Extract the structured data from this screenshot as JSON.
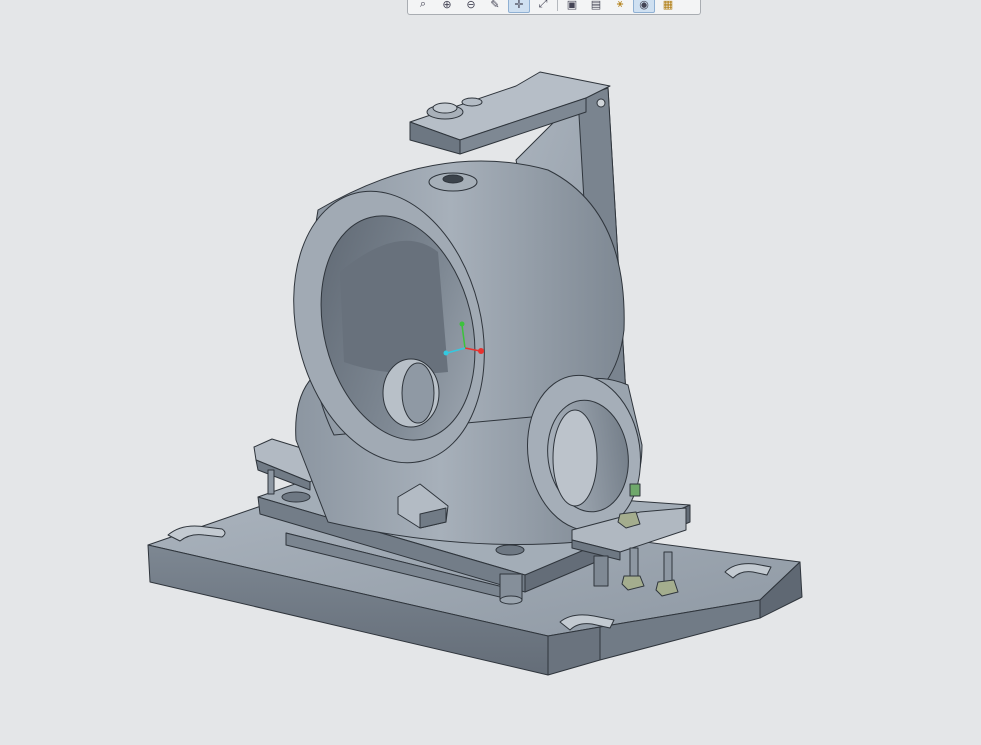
{
  "toolbar": {
    "buttons": [
      {
        "name": "zoom-fit-icon",
        "glyph": "⌕",
        "active": false
      },
      {
        "name": "zoom-in-icon",
        "glyph": "⊕",
        "active": false
      },
      {
        "name": "zoom-out-icon",
        "glyph": "⊖",
        "active": false
      },
      {
        "name": "repaint-icon",
        "glyph": "✎",
        "active": false
      },
      {
        "name": "spin-center-icon",
        "glyph": "✛",
        "active": true
      },
      {
        "name": "orient-icon",
        "glyph": "⤢",
        "active": false
      },
      {
        "name": "saved-views-icon",
        "glyph": "▣",
        "active": false
      },
      {
        "name": "layers-icon",
        "glyph": "▤",
        "active": false
      },
      {
        "name": "datum-display-icon",
        "glyph": "⚹",
        "active": false
      },
      {
        "name": "appearance-icon",
        "glyph": "◉",
        "active": true
      },
      {
        "name": "annotation-display-icon",
        "glyph": "▦",
        "active": false
      }
    ]
  },
  "model": {
    "body_color": "#99a3ae",
    "shadow_color": "#6f7985",
    "edge_color": "#2f353c",
    "triad": {
      "x_color": "#e8322f",
      "y_color": "#3cc23c",
      "z_color": "#33c9e0"
    }
  }
}
